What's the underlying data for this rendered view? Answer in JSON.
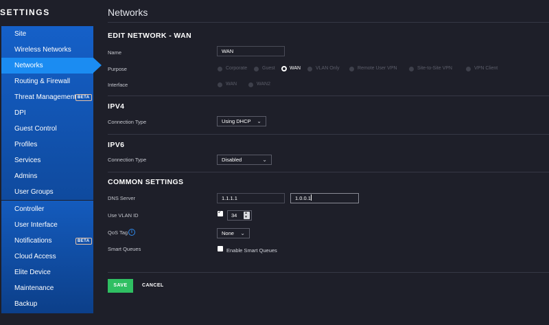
{
  "sidebar": {
    "title": "SETTINGS",
    "group1": [
      {
        "label": "Site",
        "active": false
      },
      {
        "label": "Wireless Networks",
        "active": false
      },
      {
        "label": "Networks",
        "active": true
      },
      {
        "label": "Routing & Firewall",
        "active": false
      },
      {
        "label": "Threat Management",
        "active": false,
        "badge": "BETA"
      },
      {
        "label": "DPI",
        "active": false
      },
      {
        "label": "Guest Control",
        "active": false
      },
      {
        "label": "Profiles",
        "active": false
      },
      {
        "label": "Services",
        "active": false
      },
      {
        "label": "Admins",
        "active": false
      },
      {
        "label": "User Groups",
        "active": false
      }
    ],
    "group2": [
      {
        "label": "Controller"
      },
      {
        "label": "User Interface"
      },
      {
        "label": "Notifications",
        "badge": "BETA"
      },
      {
        "label": "Cloud Access"
      },
      {
        "label": "Elite Device"
      },
      {
        "label": "Maintenance"
      },
      {
        "label": "Backup"
      }
    ]
  },
  "page": {
    "title": "Networks",
    "edit_title": "EDIT NETWORK - WAN",
    "name_label": "Name",
    "name_value": "WAN",
    "purpose_label": "Purpose",
    "purpose_options": [
      "Corporate",
      "Guest",
      "WAN",
      "VLAN Only",
      "Remote User VPN",
      "Site-to-Site VPN",
      "VPN Client"
    ],
    "purpose_selected": "WAN",
    "interface_label": "Interface",
    "interface_options": [
      "WAN",
      "WAN2"
    ],
    "ipv4_title": "IPV4",
    "ipv4_conn_label": "Connection Type",
    "ipv4_conn_value": "Using DHCP",
    "ipv6_title": "IPV6",
    "ipv6_conn_label": "Connection Type",
    "ipv6_conn_value": "Disabled",
    "common_title": "COMMON SETTINGS",
    "dns_label": "DNS Server",
    "dns1": "1.1.1.1",
    "dns2": "1.0.0.1",
    "vlan_label": "Use VLAN ID",
    "vlan_checked": true,
    "vlan_value": "34",
    "qos_label": "QoS Tag",
    "qos_value": "None",
    "smart_label": "Smart Queues",
    "smart_checkbox_label": "Enable Smart Queues",
    "smart_checked": false,
    "save_label": "SAVE",
    "cancel_label": "CANCEL"
  },
  "colors": {
    "sidebar_bg": "#1560c8",
    "active_item": "#1b8cf2",
    "save_button": "#2fbf62",
    "background": "#1e1f29"
  }
}
